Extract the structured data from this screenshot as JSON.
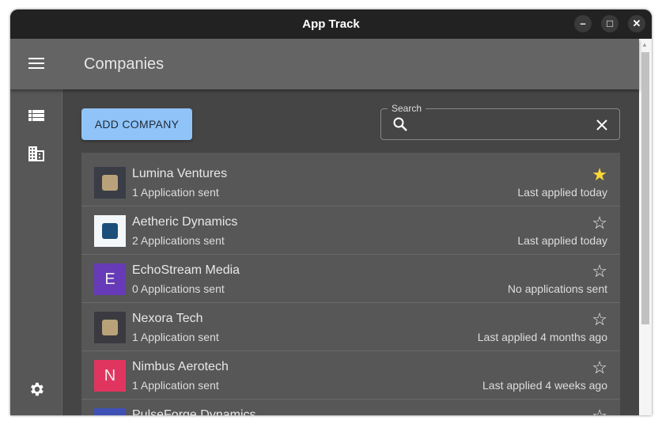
{
  "window": {
    "title": "App Track"
  },
  "appbar": {
    "title": "Companies"
  },
  "toolbar": {
    "add_label": "ADD COMPANY"
  },
  "search": {
    "label": "Search",
    "value": "",
    "placeholder": ""
  },
  "companies": [
    {
      "name": "Lumina Ventures",
      "sent": "1 Application sent",
      "last": "Last applied today",
      "favorite": true,
      "avatar": "logo",
      "bg": "#3a3d45"
    },
    {
      "name": "Aetheric Dynamics",
      "sent": "2 Applications sent",
      "last": "Last applied today",
      "favorite": false,
      "avatar": "logo",
      "bg": "#f4f7fa"
    },
    {
      "name": "EchoStream Media",
      "sent": "0 Applications sent",
      "last": "No applications sent",
      "favorite": false,
      "avatar": "E",
      "bg": "#673ab7"
    },
    {
      "name": "Nexora Tech",
      "sent": "1 Application sent",
      "last": "Last applied 4 months ago",
      "favorite": false,
      "avatar": "logo",
      "bg": "#3b3a40"
    },
    {
      "name": "Nimbus Aerotech",
      "sent": "1 Application sent",
      "last": "Last applied 4 weeks ago",
      "favorite": false,
      "avatar": "N",
      "bg": "#e0355f"
    },
    {
      "name": "PulseForge Dynamics",
      "sent": "",
      "last": "",
      "favorite": false,
      "avatar": "",
      "bg": "#3f51b5"
    }
  ],
  "colors": {
    "accent": "#90c4f9",
    "star_filled": "#fdd835"
  }
}
